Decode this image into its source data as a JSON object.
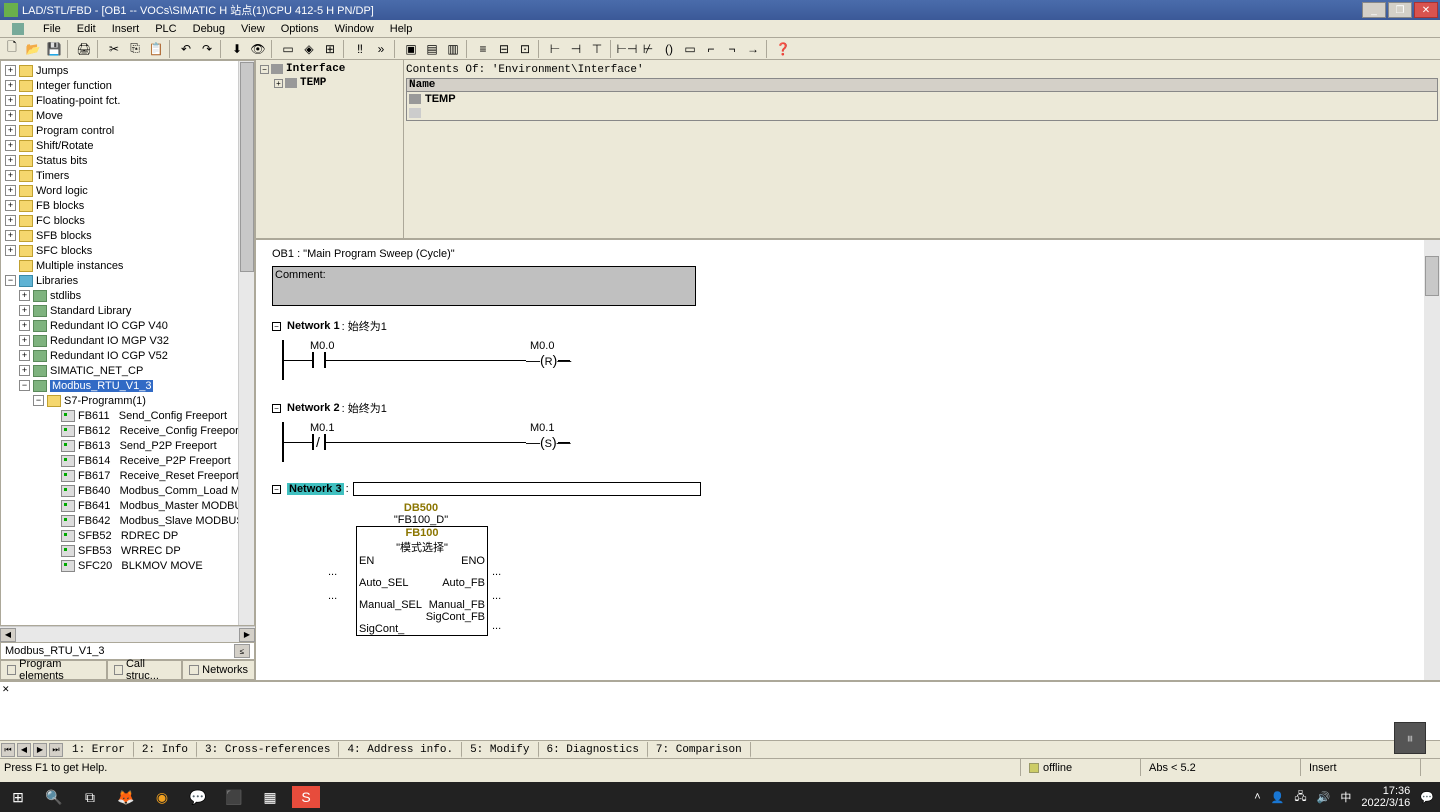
{
  "title": "LAD/STL/FBD  - [OB1 -- VOCs\\SIMATIC H 站点(1)\\CPU 412-5 H PN/DP]",
  "menu": [
    "File",
    "Edit",
    "Insert",
    "PLC",
    "Debug",
    "View",
    "Options",
    "Window",
    "Help"
  ],
  "tree": {
    "top": [
      {
        "label": "Jumps"
      },
      {
        "label": "Integer function"
      },
      {
        "label": "Floating-point fct."
      },
      {
        "label": "Move"
      },
      {
        "label": "Program control"
      },
      {
        "label": "Shift/Rotate"
      },
      {
        "label": "Status bits"
      },
      {
        "label": "Timers"
      },
      {
        "label": "Word logic"
      },
      {
        "label": "FB blocks"
      },
      {
        "label": "FC blocks"
      },
      {
        "label": "SFB blocks"
      },
      {
        "label": "SFC blocks"
      },
      {
        "label": "Multiple instances"
      }
    ],
    "libraries": "Libraries",
    "libs": [
      {
        "label": "stdlibs"
      },
      {
        "label": "Standard Library"
      },
      {
        "label": "Redundant IO CGP V40"
      },
      {
        "label": "Redundant IO MGP V32"
      },
      {
        "label": "Redundant IO CGP V52"
      },
      {
        "label": "SIMATIC_NET_CP"
      }
    ],
    "modbus": "Modbus_RTU_V1_3",
    "s7prog": "S7-Programm(1)",
    "fbs": [
      {
        "id": "FB611",
        "label": "Send_Config   Freeport"
      },
      {
        "id": "FB612",
        "label": "Receive_Config   Freeport"
      },
      {
        "id": "FB613",
        "label": "Send_P2P   Freeport"
      },
      {
        "id": "FB614",
        "label": "Receive_P2P   Freeport"
      },
      {
        "id": "FB617",
        "label": "Receive_Reset   Freeport"
      },
      {
        "id": "FB640",
        "label": "Modbus_Comm_Load   MO"
      },
      {
        "id": "FB641",
        "label": "Modbus_Master   MODBUS"
      },
      {
        "id": "FB642",
        "label": "Modbus_Slave   MODBUS"
      },
      {
        "id": "SFB52",
        "label": "RDREC   DP"
      },
      {
        "id": "SFB53",
        "label": "WRREC   DP"
      },
      {
        "id": "SFC20",
        "label": "BLKMOV   MOVE"
      }
    ]
  },
  "selpath": "Modbus_RTU_V1_3",
  "lefttabs": [
    "Program elements",
    "Call struc...",
    "Networks"
  ],
  "interface": {
    "header": "Contents Of: 'Environment\\Interface'",
    "root": "Interface",
    "child": "TEMP",
    "namecol": "Name",
    "namerow": "TEMP"
  },
  "ob1": "OB1 : \"Main Program Sweep (Cycle)\"",
  "comment": "Comment:",
  "net1": {
    "label": "Network 1",
    "title": ": 始终为1",
    "m0": "M0.0",
    "m1": "M0.0",
    "coil": "R"
  },
  "net2": {
    "label": "Network 2",
    "title": ": 始终为1",
    "m0": "M0.1",
    "m1": "M0.1",
    "coil": "S"
  },
  "net3": {
    "label": "Network 3",
    "title": ":"
  },
  "fbcall": {
    "db": "DB500",
    "dbsym": "\"FB100_D\"",
    "fb": "FB100",
    "fbsym": "\"模式选择\"",
    "pins_left": [
      "EN",
      "Auto_SEL",
      "Manual_SEL",
      "SigCont_"
    ],
    "pins_right": [
      "ENO",
      "Auto_FB",
      "Manual_FB",
      "SigCont_FB"
    ],
    "dots": "..."
  },
  "outtabs": [
    "1: Error",
    "2: Info",
    "3: Cross-references",
    "4: Address info.",
    "5: Modify",
    "6: Diagnostics",
    "7: Comparison"
  ],
  "status": {
    "help": "Press F1 to get Help.",
    "offline": "offline",
    "abs": "Abs < 5.2",
    "insert": "Insert"
  },
  "systray": {
    "ime": "中",
    "time": "17:36",
    "date": "2022/3/16"
  }
}
